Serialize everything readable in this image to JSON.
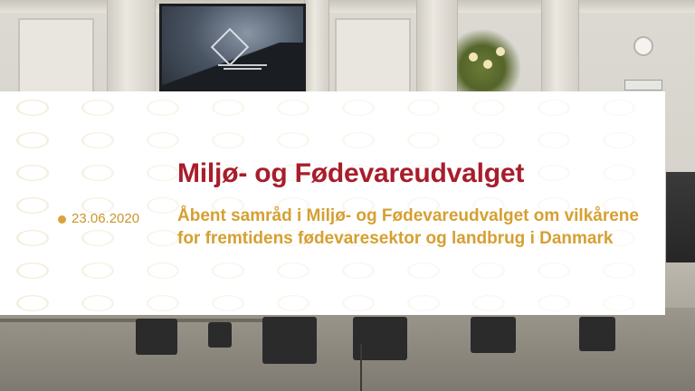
{
  "overlay": {
    "committee_title": "Miljø- og Fødevareudvalget",
    "date": "23.06.2020",
    "description": "Åbent samråd i Miljø- og Fødevareudvalget om vilkårene for fremtidens fødevaresektor og landbrug i Danmark"
  },
  "colors": {
    "title": "#a81d2c",
    "accent_gold": "#d5a032",
    "card_background": "#ffffff",
    "pattern_gold": "#e4d6aa"
  },
  "icons": {
    "date_marker": "bullet-dot-icon",
    "projector_logo": "diamond-logo-icon"
  }
}
